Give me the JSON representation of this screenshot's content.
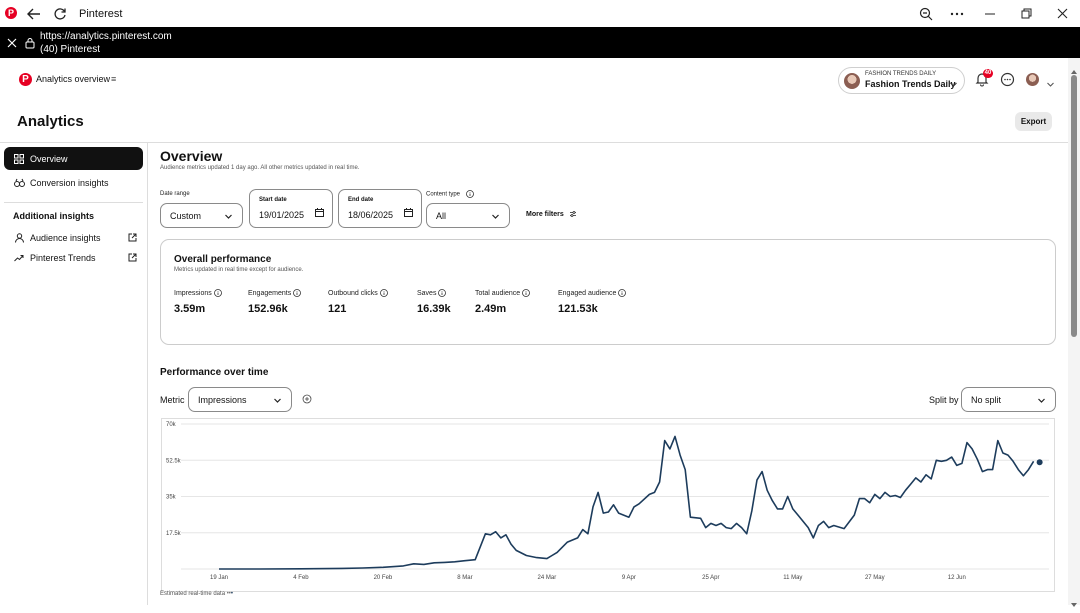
{
  "window": {
    "title": "Pinterest"
  },
  "address_bar": {
    "url": "https://analytics.pinterest.com",
    "page_title": "(40) Pinterest"
  },
  "header": {
    "nav_title": "Analytics overview",
    "menu_glyph": "≡",
    "account_small": "FASHION TRENDS DAILY",
    "account_name": "Fashion Trends Daily",
    "notification_count": "40"
  },
  "page": {
    "title": "Analytics",
    "export_label": "Export"
  },
  "sidebar": {
    "items": [
      {
        "label": "Overview",
        "icon": "grid-icon"
      },
      {
        "label": "Conversion insights",
        "icon": "conversion-icon"
      }
    ],
    "additional_heading": "Additional insights",
    "additional": [
      {
        "label": "Audience insights",
        "icon": "person-icon"
      },
      {
        "label": "Pinterest Trends",
        "icon": "trend-icon"
      }
    ]
  },
  "overview": {
    "title": "Overview",
    "subtitle": "Audience metrics updated 1 day ago. All other metrics updated in real time."
  },
  "filters": {
    "date_range_label": "Date range",
    "date_range_value": "Custom",
    "start_label": "Start date",
    "start_value": "19/01/2025",
    "end_label": "End date",
    "end_value": "18/06/2025",
    "content_type_label": "Content type",
    "content_type_value": "All",
    "more_filters": "More filters"
  },
  "overall": {
    "title": "Overall performance",
    "subtitle": "Metrics updated in real time except for audience.",
    "metrics": [
      {
        "label": "Impressions",
        "value": "3.59m"
      },
      {
        "label": "Engagements",
        "value": "152.96k"
      },
      {
        "label": "Outbound clicks",
        "value": "121"
      },
      {
        "label": "Saves",
        "value": "16.39k"
      },
      {
        "label": "Total audience",
        "value": "2.49m"
      },
      {
        "label": "Engaged audience",
        "value": "121.53k"
      }
    ]
  },
  "performance": {
    "title": "Performance over time",
    "metric_label": "Metric",
    "metric_value": "Impressions",
    "split_label": "Split by",
    "split_value": "No split",
    "footnote": "Estimated real-time data"
  },
  "colors": {
    "brand": "#e60023",
    "line": "#1d3c5c"
  },
  "chart_data": {
    "type": "line",
    "ylim": [
      0,
      70000
    ],
    "y_ticks": [
      "17.5k",
      "35k",
      "52.5k",
      "70k"
    ],
    "x_ticks": [
      "19 Jan",
      "4 Feb",
      "20 Feb",
      "8 Mar",
      "24 Mar",
      "9 Apr",
      "25 Apr",
      "11 May",
      "27 May",
      "12 Jun"
    ],
    "x_tick_days": [
      0,
      16,
      32,
      48,
      64,
      80,
      96,
      112,
      128,
      144
    ],
    "series": [
      {
        "values": [
          [
            0,
            0
          ],
          [
            8,
            0
          ],
          [
            16,
            100
          ],
          [
            24,
            300
          ],
          [
            28,
            500
          ],
          [
            32,
            800
          ],
          [
            36,
            1500
          ],
          [
            38,
            2500
          ],
          [
            40,
            2200
          ],
          [
            42,
            3000
          ],
          [
            44,
            3200
          ],
          [
            46,
            3500
          ],
          [
            48,
            4000
          ],
          [
            50,
            4500
          ],
          [
            52,
            17000
          ],
          [
            53,
            16500
          ],
          [
            54,
            18000
          ],
          [
            55,
            15000
          ],
          [
            56,
            16500
          ],
          [
            57,
            12000
          ],
          [
            58,
            9000
          ],
          [
            60,
            6500
          ],
          [
            62,
            5500
          ],
          [
            64,
            5000
          ],
          [
            65,
            6500
          ],
          [
            66,
            8000
          ],
          [
            68,
            13000
          ],
          [
            70,
            15000
          ],
          [
            71,
            19000
          ],
          [
            72,
            17000
          ],
          [
            73,
            30000
          ],
          [
            74,
            37000
          ],
          [
            75,
            27000
          ],
          [
            76,
            27500
          ],
          [
            77,
            31000
          ],
          [
            78,
            27000
          ],
          [
            80,
            25000
          ],
          [
            81,
            30000
          ],
          [
            82,
            31500
          ],
          [
            84,
            36000
          ],
          [
            85,
            37000
          ],
          [
            86,
            42000
          ],
          [
            87,
            62000
          ],
          [
            88,
            58000
          ],
          [
            89,
            64000
          ],
          [
            90,
            55000
          ],
          [
            91,
            48000
          ],
          [
            92,
            25000
          ],
          [
            94,
            24500
          ],
          [
            95,
            20000
          ],
          [
            96,
            22000
          ],
          [
            97,
            21000
          ],
          [
            98,
            22000
          ],
          [
            99,
            20000
          ],
          [
            100,
            19500
          ],
          [
            101,
            22000
          ],
          [
            102,
            20000
          ],
          [
            103,
            17000
          ],
          [
            104,
            28000
          ],
          [
            105,
            43000
          ],
          [
            106,
            47000
          ],
          [
            107,
            38000
          ],
          [
            108,
            33000
          ],
          [
            109,
            29000
          ],
          [
            110,
            29000
          ],
          [
            111,
            35000
          ],
          [
            112,
            29000
          ],
          [
            113,
            26000
          ],
          [
            115,
            20000
          ],
          [
            116,
            15000
          ],
          [
            117,
            21000
          ],
          [
            118,
            23000
          ],
          [
            119,
            20000
          ],
          [
            120,
            21000
          ],
          [
            122,
            19500
          ],
          [
            124,
            26000
          ],
          [
            125,
            34000
          ],
          [
            126,
            34000
          ],
          [
            127,
            32000
          ],
          [
            128,
            36000
          ],
          [
            129,
            34000
          ],
          [
            130,
            37000
          ],
          [
            131,
            35000
          ],
          [
            132,
            35500
          ],
          [
            133,
            34500
          ],
          [
            134,
            38000
          ],
          [
            135,
            41000
          ],
          [
            136,
            44000
          ],
          [
            137,
            42000
          ],
          [
            138,
            45500
          ],
          [
            139,
            43500
          ],
          [
            140,
            52500
          ],
          [
            141,
            52000
          ],
          [
            142,
            52500
          ],
          [
            143,
            54000
          ],
          [
            144,
            50000
          ],
          [
            145,
            51000
          ],
          [
            146,
            61000
          ],
          [
            147,
            58000
          ],
          [
            148,
            53000
          ],
          [
            149,
            47000
          ],
          [
            150,
            48000
          ],
          [
            151,
            48000
          ],
          [
            152,
            62000
          ],
          [
            153,
            56000
          ],
          [
            154,
            55000
          ],
          [
            155,
            52000
          ],
          [
            156,
            48000
          ],
          [
            157,
            45000
          ],
          [
            158,
            48000
          ],
          [
            159,
            52000
          ]
        ]
      }
    ],
    "grid": true
  }
}
